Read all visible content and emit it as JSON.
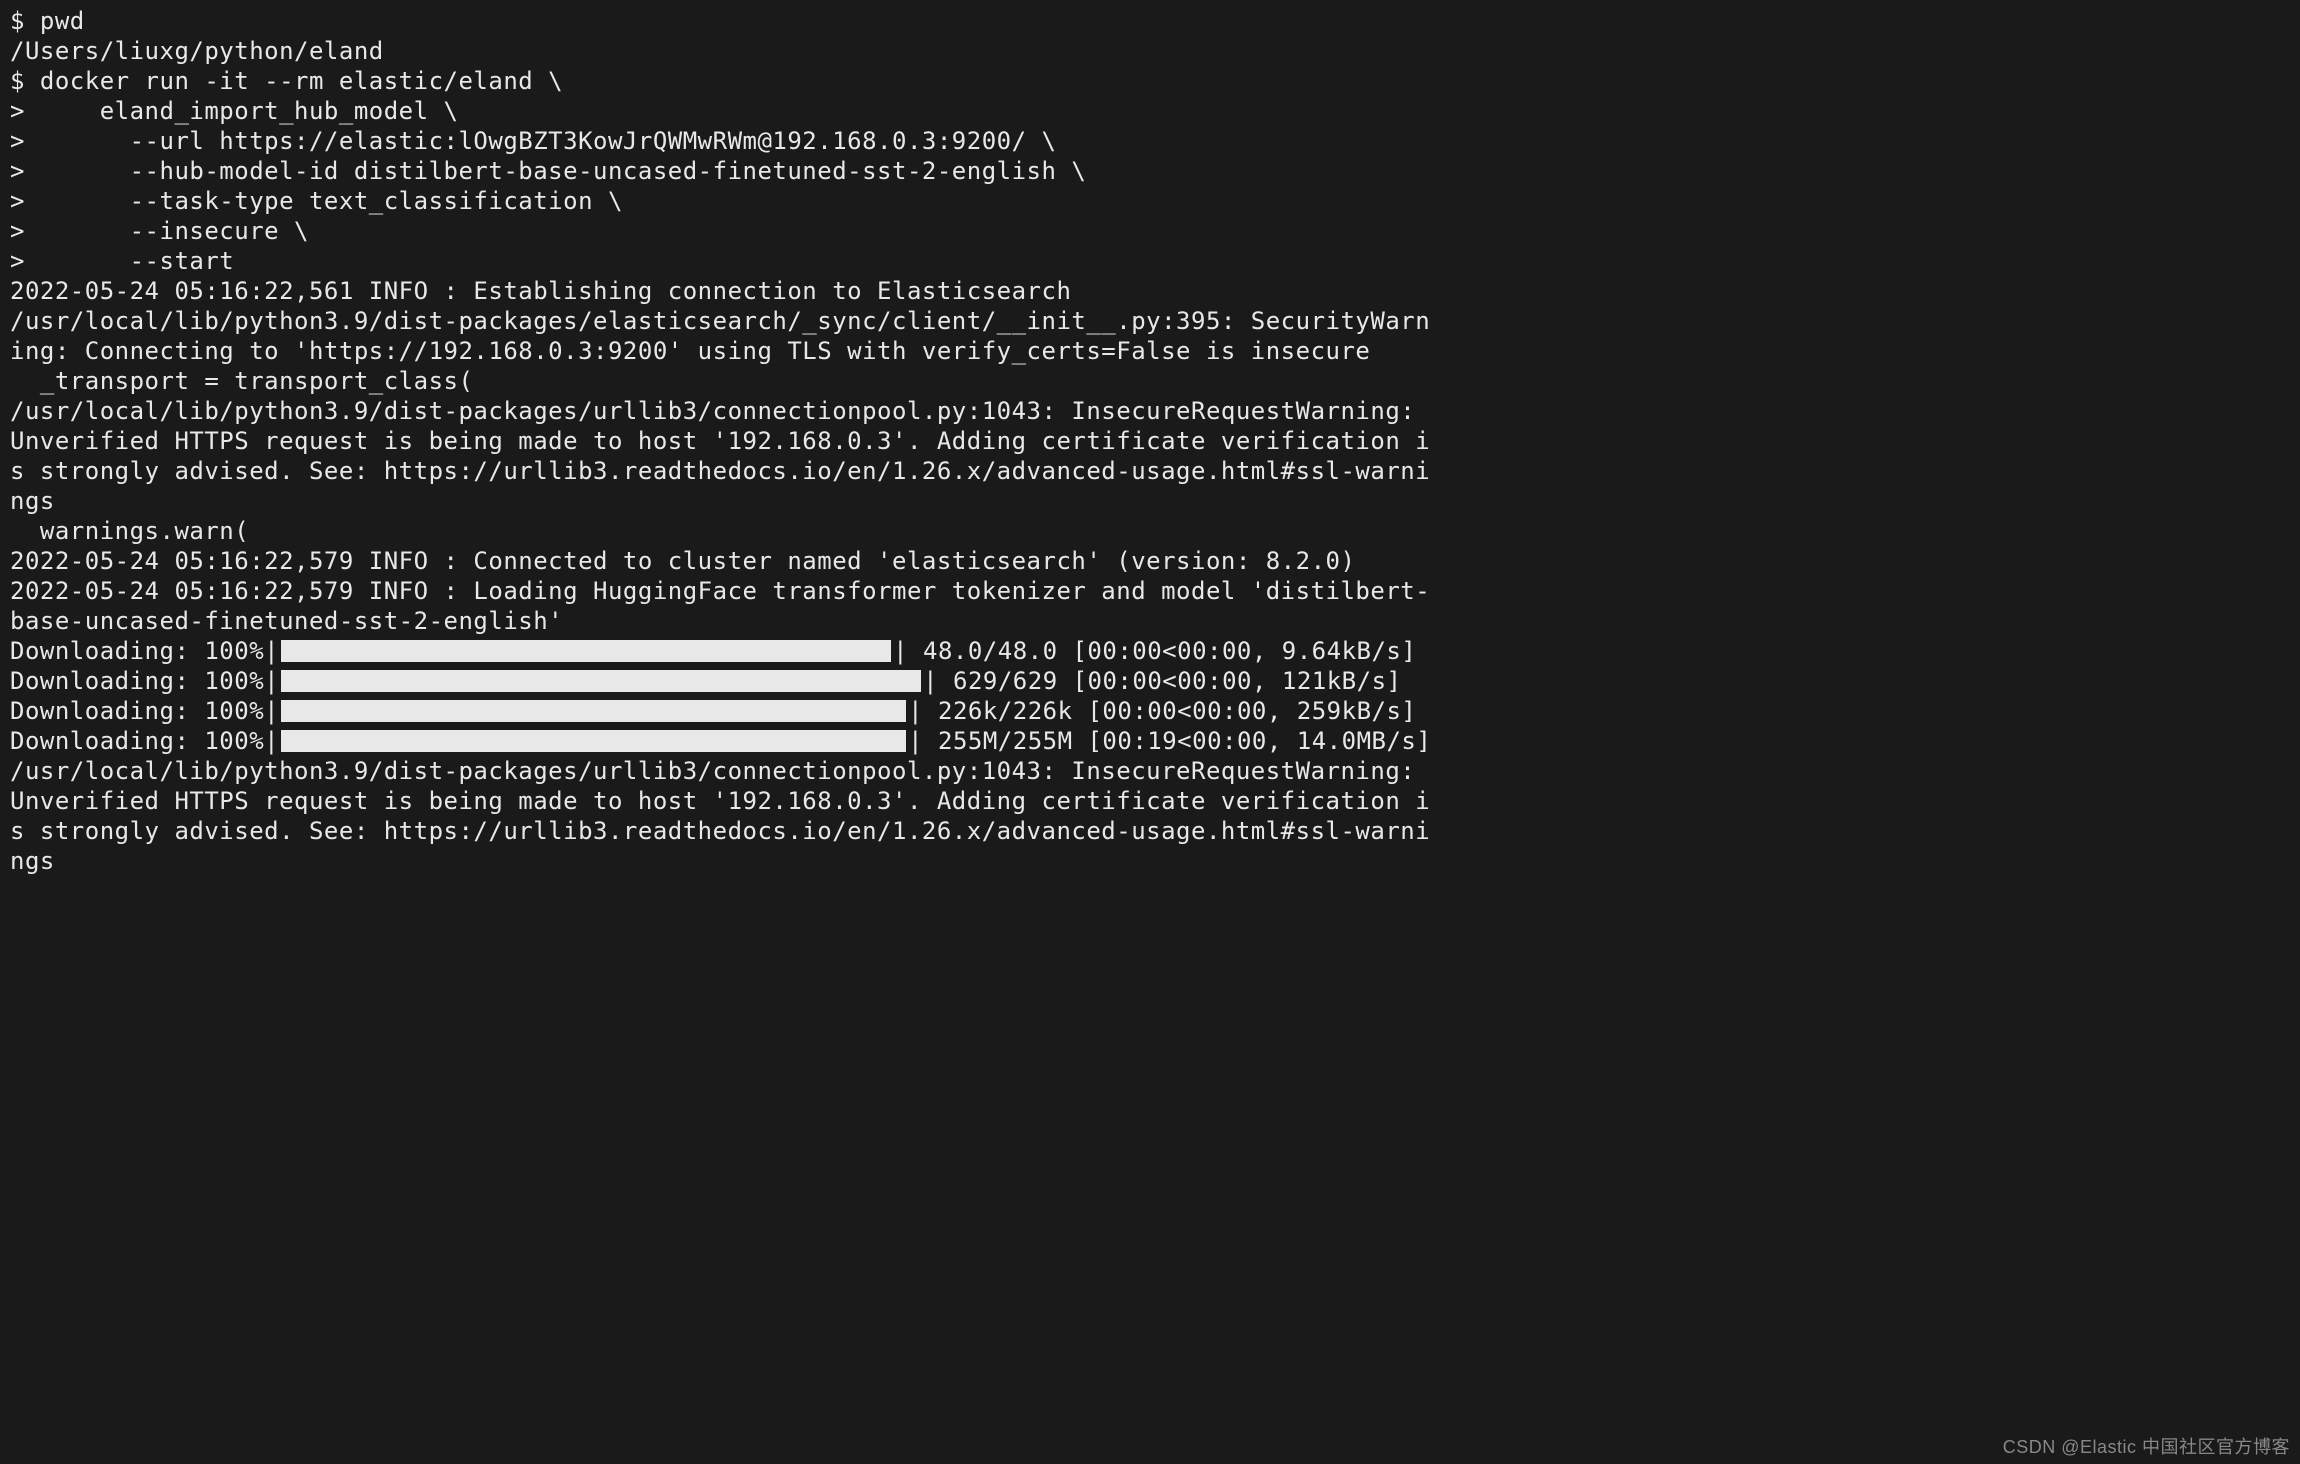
{
  "lines": {
    "l1": "$ pwd",
    "l2": "/Users/liuxg/python/eland",
    "l3": "$ docker run -it --rm elastic/eland \\",
    "l4": ">     eland_import_hub_model \\",
    "l5": ">       --url https://elastic:lOwgBZT3KowJrQWMwRWm@192.168.0.3:9200/ \\",
    "l6": ">       --hub-model-id distilbert-base-uncased-finetuned-sst-2-english \\",
    "l7": ">       --task-type text_classification \\",
    "l8": ">       --insecure \\",
    "l9": ">       --start",
    "l10": "2022-05-24 05:16:22,561 INFO : Establishing connection to Elasticsearch",
    "l11": "/usr/local/lib/python3.9/dist-packages/elasticsearch/_sync/client/__init__.py:395: SecurityWarn",
    "l12": "ing: Connecting to 'https://192.168.0.3:9200' using TLS with verify_certs=False is insecure",
    "l13": "  _transport = transport_class(",
    "l14": "/usr/local/lib/python3.9/dist-packages/urllib3/connectionpool.py:1043: InsecureRequestWarning: ",
    "l15": "Unverified HTTPS request is being made to host '192.168.0.3'. Adding certificate verification i",
    "l16": "s strongly advised. See: https://urllib3.readthedocs.io/en/1.26.x/advanced-usage.html#ssl-warni",
    "l17": "ngs",
    "l18": "  warnings.warn(",
    "l19": "2022-05-24 05:16:22,579 INFO : Connected to cluster named 'elasticsearch' (version: 8.2.0)",
    "l20": "2022-05-24 05:16:22,579 INFO : Loading HuggingFace transformer tokenizer and model 'distilbert-",
    "l21": "base-uncased-finetuned-sst-2-english'",
    "l26": "/usr/local/lib/python3.9/dist-packages/urllib3/connectionpool.py:1043: InsecureRequestWarning: ",
    "l27": "Unverified HTTPS request is being made to host '192.168.0.3'. Adding certificate verification i",
    "l28": "s strongly advised. See: https://urllib3.readthedocs.io/en/1.26.x/advanced-usage.html#ssl-warni",
    "l29": "ngs"
  },
  "progress": {
    "p1": {
      "prefix": "Downloading: 100%|",
      "suffix": "| 48.0/48.0 [00:00<00:00, 9.64kB/s]"
    },
    "p2": {
      "prefix": "Downloading: 100%|",
      "suffix": "| 629/629 [00:00<00:00, 121kB/s]"
    },
    "p3": {
      "prefix": "Downloading: 100%|",
      "suffix": "| 226k/226k [00:00<00:00, 259kB/s]"
    },
    "p4": {
      "prefix": "Downloading: 100%|",
      "suffix": "| 255M/255M [00:19<00:00, 14.0MB/s]"
    }
  },
  "watermark": "CSDN @Elastic 中国社区官方博客"
}
